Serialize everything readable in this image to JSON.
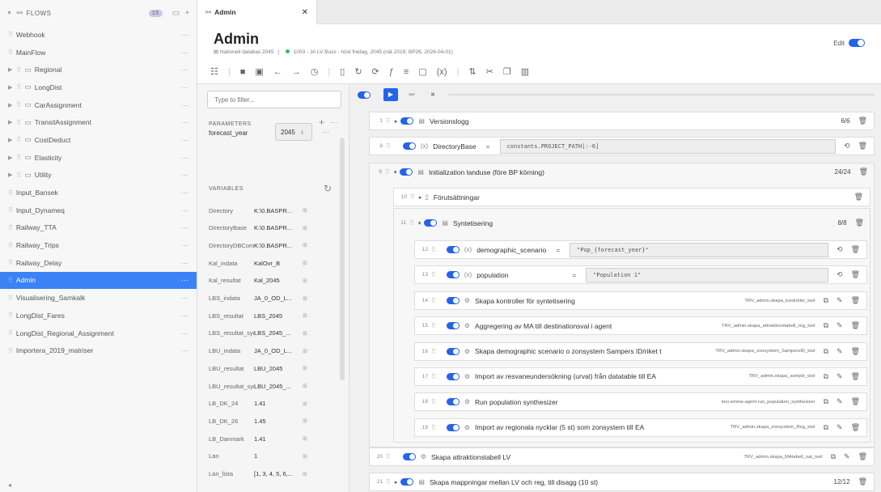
{
  "flows": {
    "header": "FLOWS",
    "count": "15",
    "items": [
      {
        "label": "Webhook",
        "expand": false,
        "folder": false,
        "sel": false
      },
      {
        "label": "MainFlow",
        "expand": false,
        "folder": false,
        "sel": false
      },
      {
        "label": "Regional",
        "expand": true,
        "folder": true,
        "sel": false
      },
      {
        "label": "LongDist",
        "expand": true,
        "folder": true,
        "sel": false
      },
      {
        "label": "CarAssignment",
        "expand": true,
        "folder": true,
        "sel": false
      },
      {
        "label": "TransitAssignment",
        "expand": true,
        "folder": true,
        "sel": false
      },
      {
        "label": "CostDeduct",
        "expand": true,
        "folder": true,
        "sel": false
      },
      {
        "label": "Elasticity",
        "expand": true,
        "folder": true,
        "sel": false
      },
      {
        "label": "Utility",
        "expand": true,
        "folder": true,
        "sel": false
      },
      {
        "label": "Input_Bansek",
        "expand": false,
        "folder": false,
        "sel": false
      },
      {
        "label": "Input_Dynameq",
        "expand": false,
        "folder": false,
        "sel": false
      },
      {
        "label": "Railway_TTA",
        "expand": false,
        "folder": false,
        "sel": false
      },
      {
        "label": "Railway_Trips",
        "expand": false,
        "folder": false,
        "sel": false
      },
      {
        "label": "Railway_Delay",
        "expand": false,
        "folder": false,
        "sel": false
      },
      {
        "label": "Admin",
        "expand": false,
        "folder": false,
        "sel": true
      },
      {
        "label": "Visualisering_Samkalk",
        "expand": false,
        "folder": false,
        "sel": false
      },
      {
        "label": "LongDist_Fares",
        "expand": false,
        "folder": false,
        "sel": false
      },
      {
        "label": "LongDist_Regional_Assignment",
        "expand": false,
        "folder": false,
        "sel": false
      },
      {
        "label": "Importera_2019_matriser",
        "expand": false,
        "folder": false,
        "sel": false
      }
    ]
  },
  "tab": {
    "title": "Admin"
  },
  "header": {
    "title": "Admin",
    "db": "Nationell databas 2045",
    "scenario": "1003 - JA LV Buss - höst fredag, 2045 (nät 2019, BP26, 2026-04-01)",
    "edit_label": "Edit"
  },
  "filter": {
    "placeholder": "Type to filter..."
  },
  "parameters": {
    "heading": "PARAMETERS",
    "forecast_year_label": "forecast_year",
    "forecast_year_value": "2045"
  },
  "variables": {
    "heading": "VARIABLES",
    "rows": [
      {
        "name": "Directory",
        "value": "K:\\0.BASPR..."
      },
      {
        "name": "DirectoryBase",
        "value": "K:\\0.BASPR..."
      },
      {
        "name": "DirectoryDBCompl...",
        "value": "K:\\0.BASPR..."
      },
      {
        "name": "Kal_indata",
        "value": "KalOvr_B"
      },
      {
        "name": "Kal_resultat",
        "value": "Kal_2045"
      },
      {
        "name": "LBS_indata",
        "value": "JA_0_OD_L..."
      },
      {
        "name": "LBS_resultat",
        "value": "LBS_2045"
      },
      {
        "name": "LBS_resultat_sym",
        "value": "LBS_2045_..."
      },
      {
        "name": "LBU_indata",
        "value": "JA_0_OD_L..."
      },
      {
        "name": "LBU_resultat",
        "value": "LBU_2045"
      },
      {
        "name": "LBU_resultat_sym",
        "value": "LBU_2045_..."
      },
      {
        "name": "LB_DK_24",
        "value": "1.41"
      },
      {
        "name": "LB_DK_26",
        "value": "1.45"
      },
      {
        "name": "LB_Danmark",
        "value": "1.41"
      },
      {
        "name": "Lan",
        "value": "1"
      },
      {
        "name": "Lan_lista",
        "value": "[1, 3, 4, 5, 6,..."
      }
    ]
  },
  "steps": {
    "s1": {
      "num": "1",
      "label": "Versionslogg",
      "count": "6/6"
    },
    "s8": {
      "num": "8",
      "label": "DirectoryBase",
      "expr": "constants.PROJECT_PATH[:-6]"
    },
    "s9": {
      "num": "9",
      "label": "Initialization landuse (före BP körning)",
      "count": "24/24"
    },
    "s10": {
      "num": "10",
      "label": "Förutsättningar"
    },
    "s11": {
      "num": "11",
      "label": "Syntetisering",
      "count": "8/8"
    },
    "s12": {
      "num": "12",
      "label": "demographic_scenario",
      "expr": "\"Pop_{forecast_year}\""
    },
    "s13": {
      "num": "13",
      "label": "population",
      "expr": "\"Population 1\""
    },
    "s14": {
      "num": "14",
      "label": "Skapa kontroller för syntetisering",
      "tool": "TRV_admin.skapa_kontroller_tool"
    },
    "s15": {
      "num": "15",
      "label": "Aggregering av MA till destinationsval i agent",
      "tool": "TRV_admin.skapa_attraktionstabell_reg_tool"
    },
    "s16": {
      "num": "16",
      "label": "Skapa demographic scenario o zonsystem Sampers ID/riket t",
      "tool": "TRV_admin.skapa_zonsystem_SampersID_tool"
    },
    "s17": {
      "num": "17",
      "label": "Import av resvaneundersökning (urval) från datatable till EA",
      "tool": "TRV_admin.skapa_sample_tool"
    },
    "s18": {
      "num": "18",
      "label": "Run population synthesizer",
      "tool": "inro.emme.agent.run_population_synthesizer"
    },
    "s19": {
      "num": "19",
      "label": "Import av regionala nycklar (5 st) som zonsystem till EA",
      "tool": "TRV_admin.skapa_zonsystem_Reg_tool"
    },
    "s20": {
      "num": "20",
      "label": "Skapa attraktionstabell LV",
      "tool": "TRV_admin.skapa_MAtabell_nat_tool"
    },
    "s21": {
      "num": "21",
      "label": "Skapa mappningar mellan LV och reg, till disagg (10 st)",
      "count": "12/12"
    }
  },
  "colors": {
    "accent": "#2563eb",
    "selected": "#3b82f6"
  }
}
